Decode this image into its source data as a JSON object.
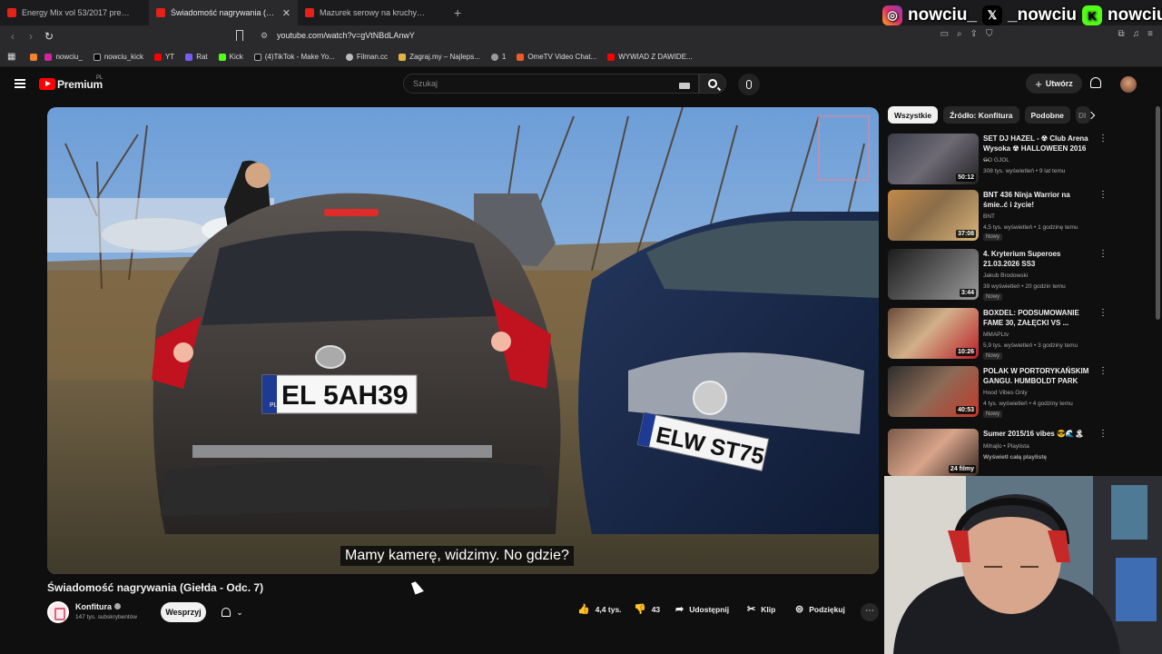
{
  "browser": {
    "tabs": [
      {
        "title": "Energy Mix vol 53/2017 pres The",
        "active": false
      },
      {
        "title": "Świadomość nagrywania (Giełda",
        "active": true
      },
      {
        "title": "Mazurek serowy na kruchym spodzie",
        "active": false
      }
    ],
    "new_tab": "+",
    "url": "youtube.com/watch?v=gVtNBdLAnwY",
    "bookmarks": [
      "nowciu_",
      "nowciu_kick",
      "YT",
      "Rat",
      "Kick",
      "(4)TikTok - Make Yo...",
      "Filman.cc",
      "Zagraj.my – Najleps...",
      "1",
      "OmeTV Video Chat...",
      "WYWIAD Z DAWIDE..."
    ]
  },
  "overlay": {
    "instagram": "nowciu_",
    "x": "_nowciu",
    "kick": "nowciu"
  },
  "header": {
    "brand": "Premium",
    "country": "PL",
    "search_placeholder": "Szukaj",
    "create_label": "Utwórz"
  },
  "video": {
    "subtitle": "Mamy kamerę, widzimy. No gdzie?",
    "title": "Świadomość nagrywania (Giełda - Odc. 7)",
    "plate_left": "EL 5AH39",
    "plate_right": "ELW ST75",
    "plate_country": "PL"
  },
  "channel": {
    "name": "Konfitura",
    "subs": "147 tys. subskrybentów",
    "support_label": "Wesprzyj"
  },
  "actions": {
    "likes": "4,4 tys.",
    "dislikes": "43",
    "share": "Udostępnij",
    "clip": "Klip",
    "thanks": "Podziękuj"
  },
  "sidebar": {
    "chips": [
      "Wszystkie",
      "Źródło: Konfitura",
      "Podobne",
      "Dl"
    ],
    "items": [
      {
        "title": "SET DJ HAZEL - ☢ Club Arena Wysoka ☢ HALLOWEEN 2016 ...",
        "channel": "GO GJOL",
        "meta": "308 tys. wyświetleń • 9 lat temu",
        "badge": "",
        "duration": "50:12"
      },
      {
        "title": "BNT 436 Ninja Warrior na śmie..ć i życie!",
        "channel": "BNT",
        "meta": "4,5 tys. wyświetleń • 1 godzinę temu",
        "badge": "Nowy",
        "duration": "37:08"
      },
      {
        "title": "4. Kryterium Superoes 21.03.2026 SS3",
        "channel": "Jakub Brodowski",
        "meta": "39 wyświetleń • 20 godzin temu",
        "badge": "Nowy",
        "duration": "3:44"
      },
      {
        "title": "BOXDEL: PODSUMOWANIE FAME 30, ZAŁĘCKI VS ...",
        "channel": "MMAPLtv",
        "meta": "5,9 tys. wyświetleń • 3 godziny temu",
        "badge": "Nowy",
        "duration": "10:26"
      },
      {
        "title": "POLAK W PORTORYKAŃSKIM GANGU. HUMBOLDT PARK",
        "channel": "Hood Vibes Only",
        "meta": "4 tys. wyświetleń • 4 godziny temu",
        "badge": "Nowy",
        "duration": "40:53"
      },
      {
        "title": "Sumer 2015/16 vibes 😎🌊🏝",
        "channel": "Mihajlo • Playlista",
        "meta": "Wyświetl całą playlistę",
        "badge": "",
        "duration": "24 filmy"
      }
    ]
  }
}
